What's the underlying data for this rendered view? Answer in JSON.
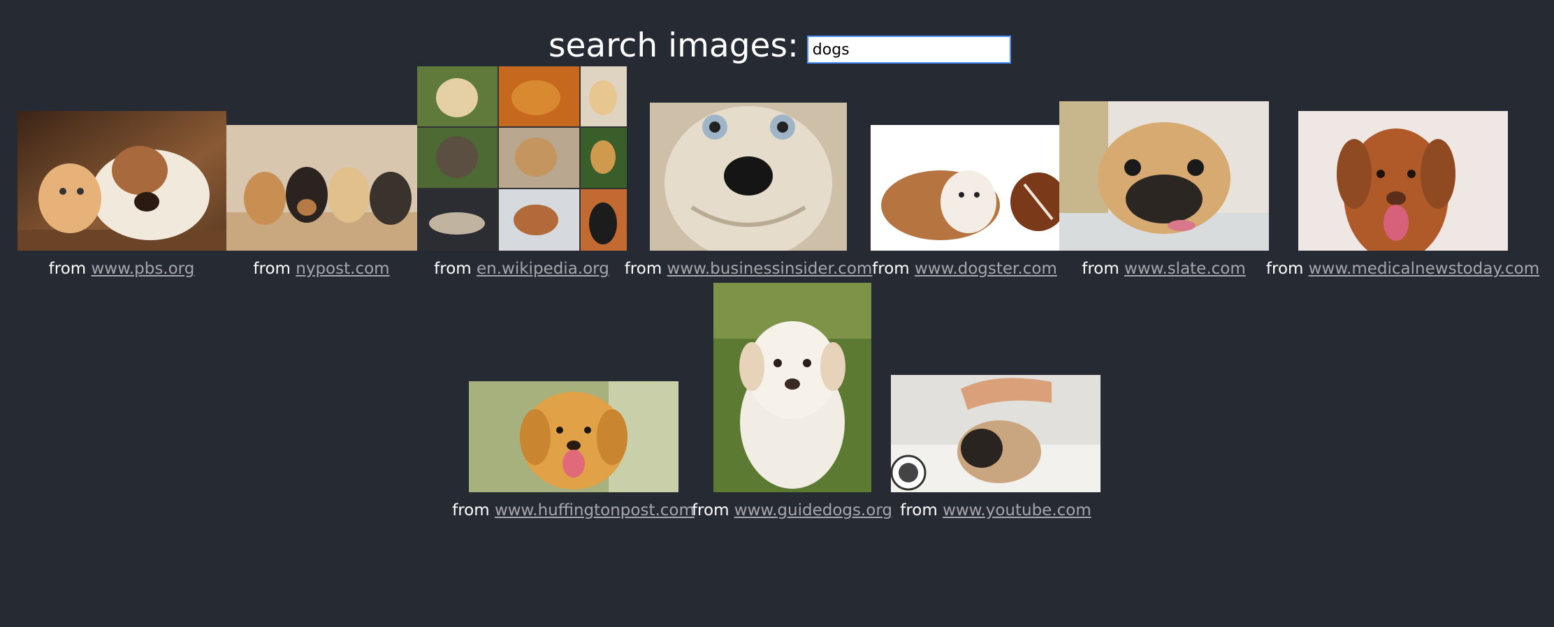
{
  "search": {
    "label": "search images:",
    "value": "dogs"
  },
  "results": [
    {
      "prefix": "from",
      "source": "www.pbs.org"
    },
    {
      "prefix": "from",
      "source": "nypost.com"
    },
    {
      "prefix": "from",
      "source": "en.wikipedia.org"
    },
    {
      "prefix": "from",
      "source": "www.businessinsider.com"
    },
    {
      "prefix": "from",
      "source": "www.dogster.com"
    },
    {
      "prefix": "from",
      "source": "www.slate.com"
    },
    {
      "prefix": "from",
      "source": "www.medicalnewstoday.com"
    },
    {
      "prefix": "from",
      "source": "www.huffingtonpost.com"
    },
    {
      "prefix": "from",
      "source": "www.guidedogs.org"
    },
    {
      "prefix": "from",
      "source": "www.youtube.com"
    }
  ]
}
